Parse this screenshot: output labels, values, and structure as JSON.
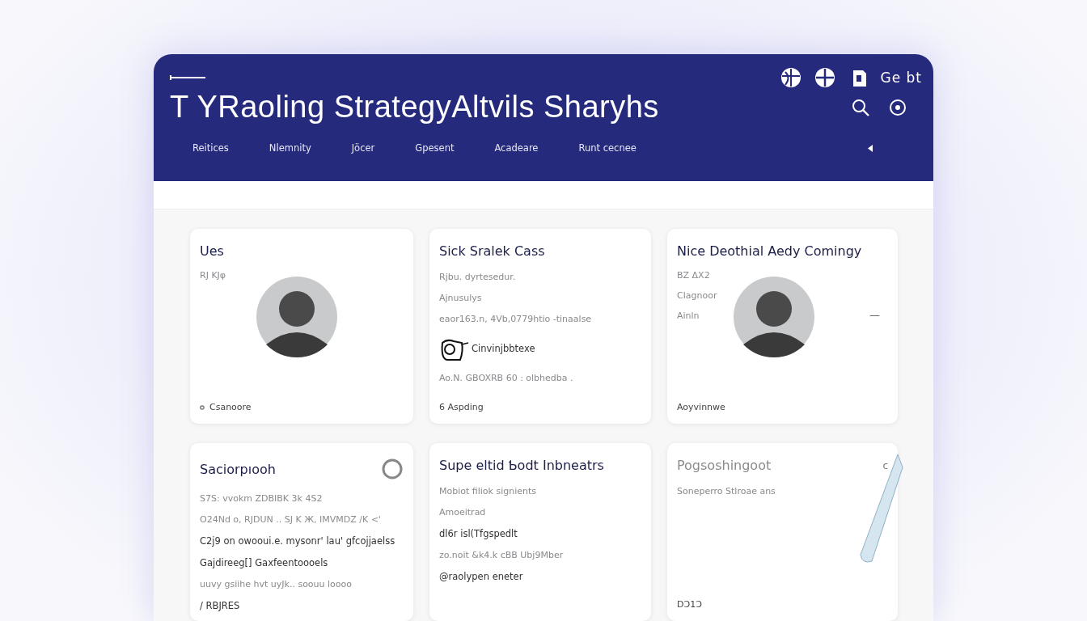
{
  "header": {
    "title": "T YRaoling StrategyAltvils Sharyhs",
    "account_label": "Ge bt",
    "nav": [
      {
        "label": "Reitices"
      },
      {
        "label": "Nlemnity"
      },
      {
        "label": "Jöcer"
      },
      {
        "label": "Gpesent"
      },
      {
        "label": "Acadeare"
      },
      {
        "label": "Runt cecnee"
      }
    ]
  },
  "cards": [
    {
      "kind": "avatar",
      "title": "Ues",
      "lines": [
        {
          "kind": "muted",
          "text": "RJ KJφ"
        }
      ],
      "footer": {
        "kind": "bullet",
        "text": "Csanoore"
      }
    },
    {
      "kind": "text",
      "title": "Sick Sralek Cass",
      "lines": [
        {
          "kind": "muted",
          "text": "Rjbu. dyrtesedur."
        },
        {
          "kind": "muted",
          "text": "Ajnusulys"
        },
        {
          "kind": "muted",
          "text": "eaor163.n, 4Vb,0779htio -tinaalse"
        },
        {
          "kind": "icon",
          "text": "Cinvinjbbtexe"
        },
        {
          "kind": "muted",
          "text": "Ao.N. GBOXRB 60 : olbhedba ."
        }
      ],
      "footer": {
        "kind": "plain",
        "text": "6 Aspding"
      }
    },
    {
      "kind": "avatar",
      "title": "Nice Deothial Aedy Comingy",
      "lines": [
        {
          "kind": "muted",
          "text": "BZ ΔX2"
        },
        {
          "kind": "muted",
          "text": "Clagnoor"
        },
        {
          "kind": "muted",
          "text": "Ainln"
        }
      ],
      "side": "—",
      "footer": {
        "kind": "plain",
        "text": "Aoyvinnwe"
      }
    },
    {
      "kind": "ring",
      "title": "Saciorpıooh",
      "lines": [
        {
          "kind": "muted",
          "text": "S7S: vvokm ZDBIBK 3k 4S2"
        },
        {
          "kind": "muted",
          "text": "O24Nd o, RJDUN .. SJ K Ж, IMVMDZ /K <'"
        },
        {
          "kind": "body",
          "text": "C2j9 on owooui.e. mysonr' lau' gfcojjaelss"
        },
        {
          "kind": "body",
          "text": "Gajdireeg[]   Gaxfeentoooels"
        },
        {
          "kind": "muted",
          "text": "uuvy gsiihe hvt uyJk.. soouu loooo"
        },
        {
          "kind": "body",
          "text": "/ RBJRES"
        }
      ]
    },
    {
      "kind": "text",
      "title": "Supe eltid Ƅodt Inbneatrs",
      "lines": [
        {
          "kind": "muted",
          "text": "Mobiot filiok signients"
        },
        {
          "kind": "muted",
          "text": "Amoeitrad"
        },
        {
          "kind": "body",
          "text": "dl6r isl(Tfgspedlt"
        },
        {
          "kind": "muted",
          "text": "zo.noit &k4.k cBB Ubj9Mber"
        },
        {
          "kind": "body",
          "text": "@raolypen eneter"
        }
      ]
    },
    {
      "kind": "blank",
      "title": "Pogsoshingoot",
      "side": "c",
      "lines": [
        {
          "kind": "muted",
          "text": "Soneperro Stlroae ans"
        }
      ],
      "footer": {
        "kind": "plain",
        "text": "DƆ1Ɔ"
      }
    }
  ]
}
